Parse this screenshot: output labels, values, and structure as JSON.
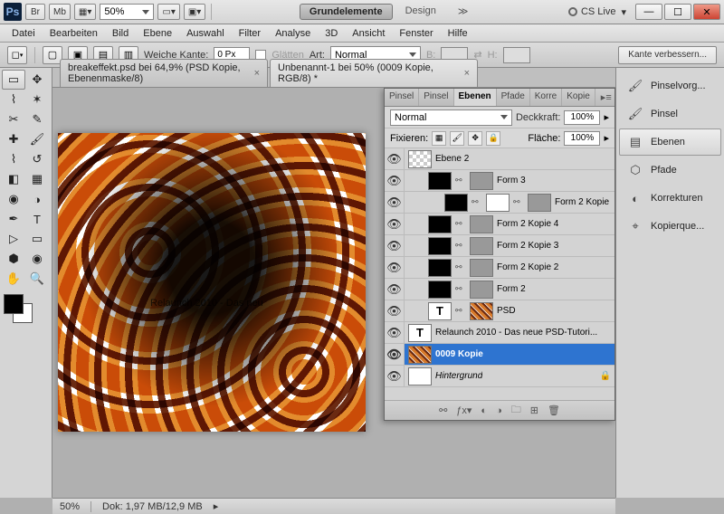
{
  "titlebar": {
    "app": "Ps",
    "mini_buttons": [
      "Br",
      "Mb"
    ],
    "zoom": "50%",
    "workspaces": {
      "active": "Grundelemente",
      "other": "Design"
    },
    "cslive": "CS Live"
  },
  "menubar": [
    "Datei",
    "Bearbeiten",
    "Bild",
    "Ebene",
    "Auswahl",
    "Filter",
    "Analyse",
    "3D",
    "Ansicht",
    "Fenster",
    "Hilfe"
  ],
  "optbar": {
    "feather_label": "Weiche Kante:",
    "feather_value": "0 Px",
    "antialias_label": "Glätten",
    "style_label": "Art:",
    "style_value": "Normal",
    "width_label": "B:",
    "height_label": "H:",
    "refine": "Kante verbessern..."
  },
  "doc_tabs": [
    {
      "label": "breakeffekt.psd bei 64,9% (PSD Kopie, Ebenenmaske/8)",
      "active": false
    },
    {
      "label": "Unbenannt-1 bei 50% (0009 Kopie, RGB/8) *",
      "active": true
    }
  ],
  "canvas_text": "Relaunch 2010 - Das neu",
  "panel": {
    "tabs": [
      "Pinsel",
      "Pinsel",
      "Ebenen",
      "Pfade",
      "Korre",
      "Kopie"
    ],
    "active_tab": "Ebenen",
    "blend_mode": "Normal",
    "opacity_label": "Deckkraft:",
    "opacity": "100%",
    "lock_label": "Fixieren:",
    "fill_label": "Fläche:",
    "fill": "100%",
    "layers": [
      {
        "name": "Ebene 2",
        "thumb": "checker",
        "indent": 0,
        "text": false
      },
      {
        "name": "Form 3",
        "thumb": "black",
        "indent": 1,
        "mask": "grey",
        "text": false
      },
      {
        "name": "Form 2 Kopie",
        "thumb": "black",
        "indent": 2,
        "mask": "white",
        "mask2": "grey",
        "text": false
      },
      {
        "name": "Form 2 Kopie 4",
        "thumb": "black",
        "indent": 1,
        "mask": "grey",
        "text": false
      },
      {
        "name": "Form 2 Kopie 3",
        "thumb": "black",
        "indent": 1,
        "mask": "grey",
        "text": false
      },
      {
        "name": "Form 2 Kopie 2",
        "thumb": "black",
        "indent": 1,
        "mask": "grey",
        "text": false
      },
      {
        "name": "Form 2",
        "thumb": "black",
        "indent": 1,
        "mask": "grey",
        "text": false
      },
      {
        "name": "PSD",
        "thumb": "T",
        "indent": 1,
        "mask": "tex",
        "text": true
      },
      {
        "name": "Relaunch 2010 - Das neue PSD-Tutori...",
        "thumb": "T",
        "indent": 0,
        "text": true
      },
      {
        "name": "0009 Kopie",
        "thumb": "tex",
        "indent": 0,
        "text": false,
        "selected": true
      },
      {
        "name": "Hintergrund",
        "thumb": "white",
        "indent": 0,
        "text": false,
        "italic": true,
        "locked": true
      }
    ]
  },
  "right_dock": [
    {
      "label": "Pinselvorg...",
      "icon": "brush"
    },
    {
      "label": "Pinsel",
      "icon": "brush2"
    },
    {
      "label": "Ebenen",
      "icon": "layers",
      "active": true
    },
    {
      "label": "Pfade",
      "icon": "paths"
    },
    {
      "label": "Korrekturen",
      "icon": "adjust"
    },
    {
      "label": "Kopierque...",
      "icon": "clone"
    }
  ],
  "statusbar": {
    "zoom": "50%",
    "doc_info": "Dok: 1,97 MB/12,9 MB"
  }
}
